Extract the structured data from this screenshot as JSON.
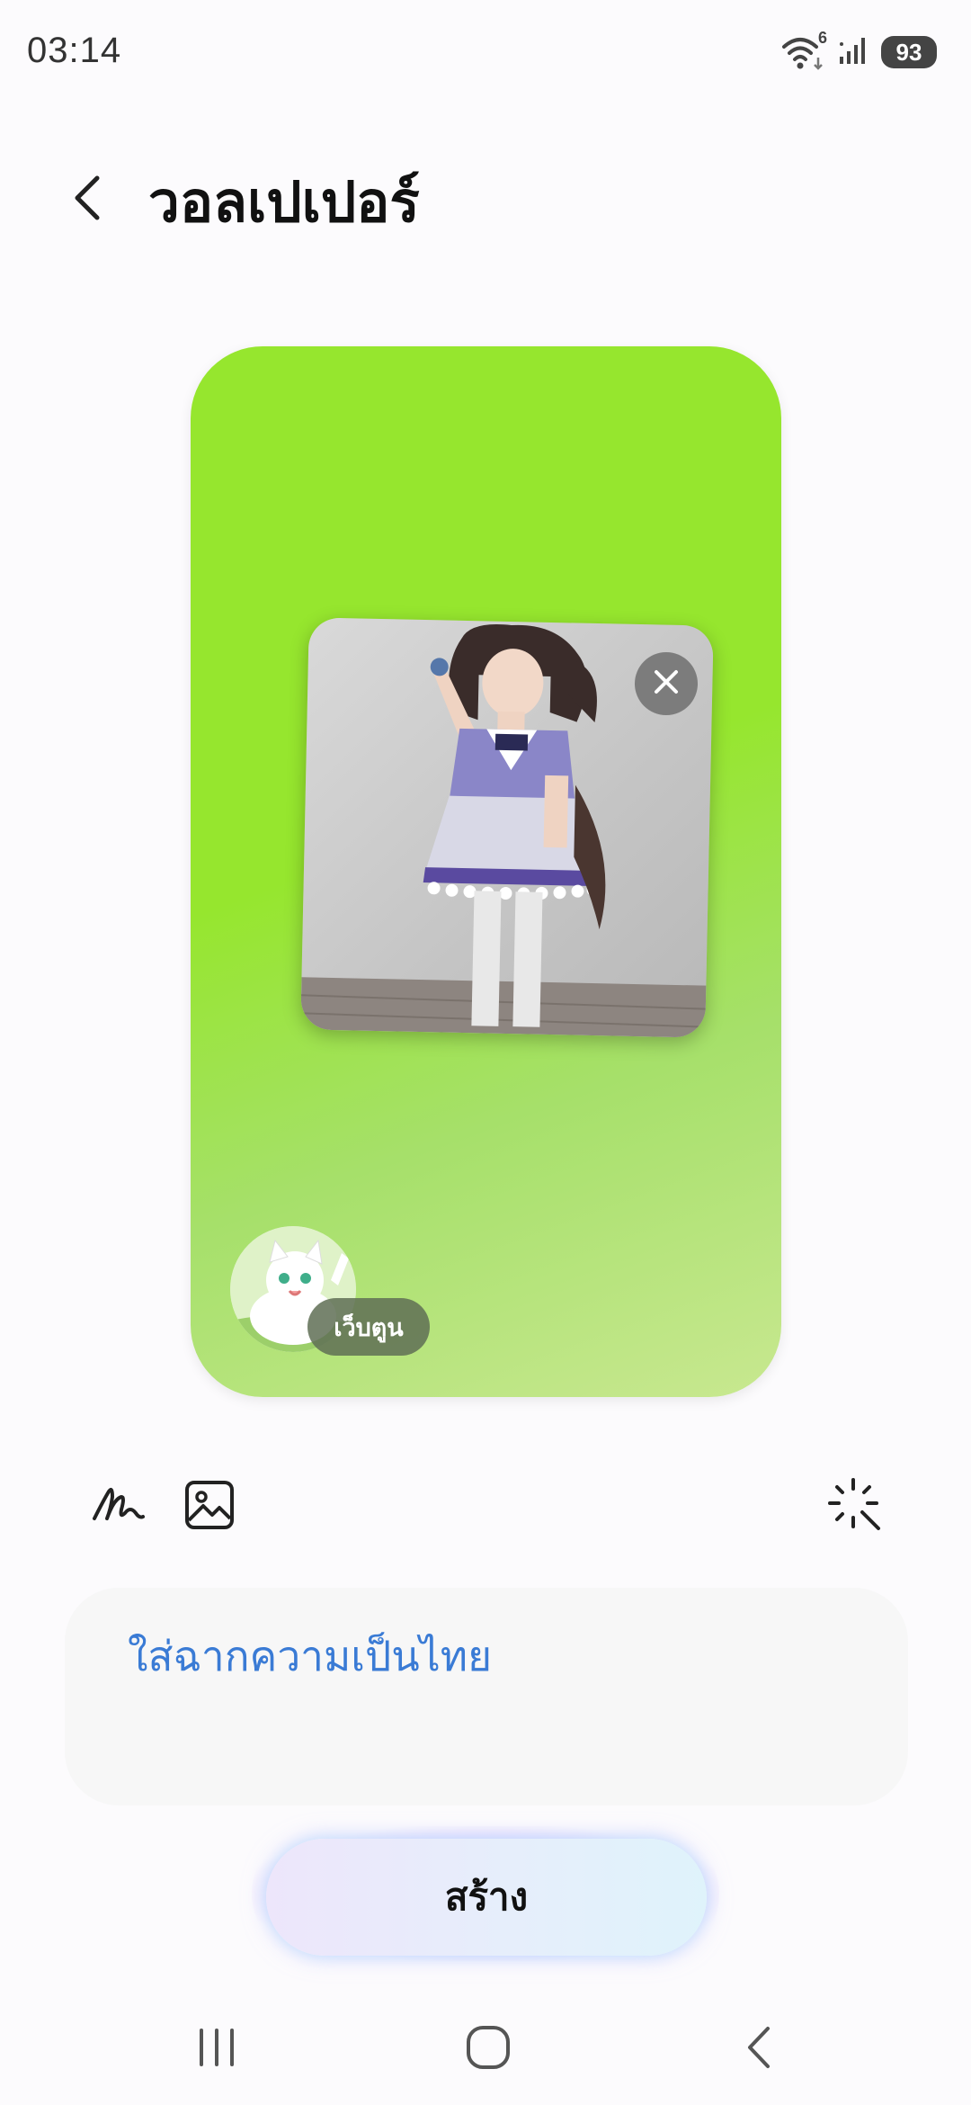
{
  "status_bar": {
    "time": "03:14",
    "wifi_badge": "6",
    "battery": "93"
  },
  "header": {
    "title": "วอลเปเปอร์"
  },
  "preview": {
    "background_color": "#96e62e",
    "avatar_label": "เว็บตูน"
  },
  "prompt": {
    "text": "ใส่ฉากความเป็นไทย"
  },
  "actions": {
    "create_label": "สร้าง"
  },
  "icons": {
    "back": "chevron-left-icon",
    "close": "close-icon",
    "handwriting": "handwriting-icon",
    "image": "image-icon",
    "sparkle": "ai-sparkle-icon",
    "recents": "recents-icon",
    "home": "home-icon",
    "nav_back": "nav-back-icon"
  },
  "colors": {
    "prompt_text": "#3a7bd5",
    "preview_green": "#96e62e"
  }
}
